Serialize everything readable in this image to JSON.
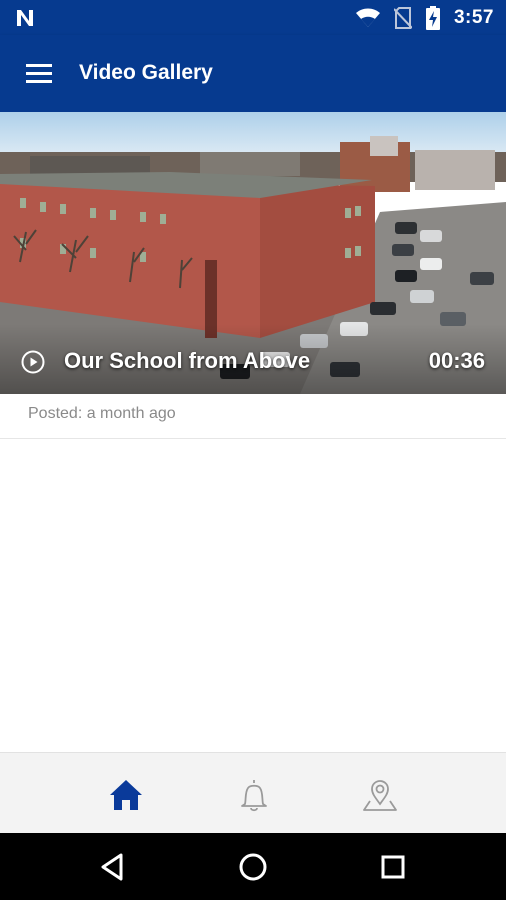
{
  "status_bar": {
    "time": "3:57",
    "icons": [
      "notification-n-icon",
      "wifi-icon",
      "no-sim-icon",
      "battery-charging-icon"
    ]
  },
  "app_bar": {
    "title": "Video Gallery",
    "menu_icon": "hamburger-menu-icon"
  },
  "videos": [
    {
      "title": "Our School from Above",
      "duration": "00:36",
      "posted": "Posted: a month ago",
      "icon": "play-circle-icon"
    }
  ],
  "bottom_nav": {
    "items": [
      {
        "icon": "home-icon",
        "active": true
      },
      {
        "icon": "bell-icon",
        "active": false
      },
      {
        "icon": "map-pin-icon",
        "active": false
      }
    ],
    "active_color": "#0a3a9a",
    "inactive_color": "#9a9a9a"
  },
  "colors": {
    "brand_blue": "#063a8f"
  }
}
